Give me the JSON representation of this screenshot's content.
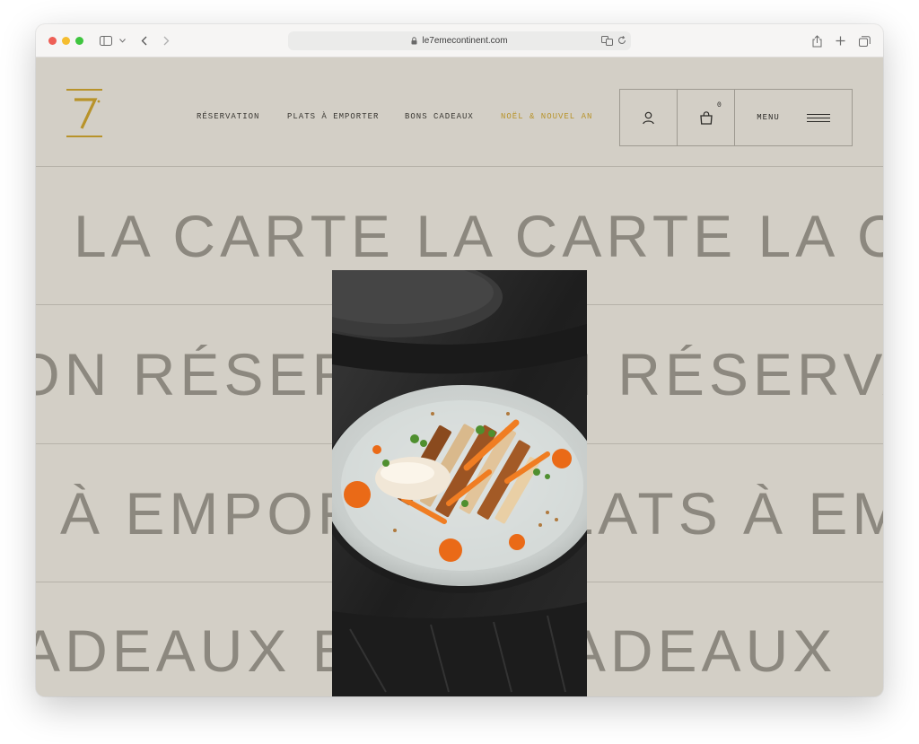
{
  "browser": {
    "url": "le7emecontinent.com"
  },
  "site": {
    "logo_text": "7",
    "nav": [
      {
        "label": "RÉSERVATION"
      },
      {
        "label": "PLATS À EMPORTER"
      },
      {
        "label": "BONS CADEAUX"
      },
      {
        "label": "NOËL & NOUVEL AN"
      }
    ],
    "cart_count": "0",
    "menu_label": "MENU",
    "marquee": [
      {
        "text": "LA CARTE   LA CARTE   LA CARTE   LA CARTE"
      },
      {
        "text": "ÉSERVATION   RÉSERVATION   RÉSERVATION"
      },
      {
        "text": "À EMPORTER   PLATS À EMPORTER"
      },
      {
        "text": "BONS CADEAUX   BONS CADEAUX"
      }
    ]
  },
  "colors": {
    "background": "#d3cfc6",
    "accent_gold": "#b8932a",
    "marquee_text": "#8c887f"
  }
}
